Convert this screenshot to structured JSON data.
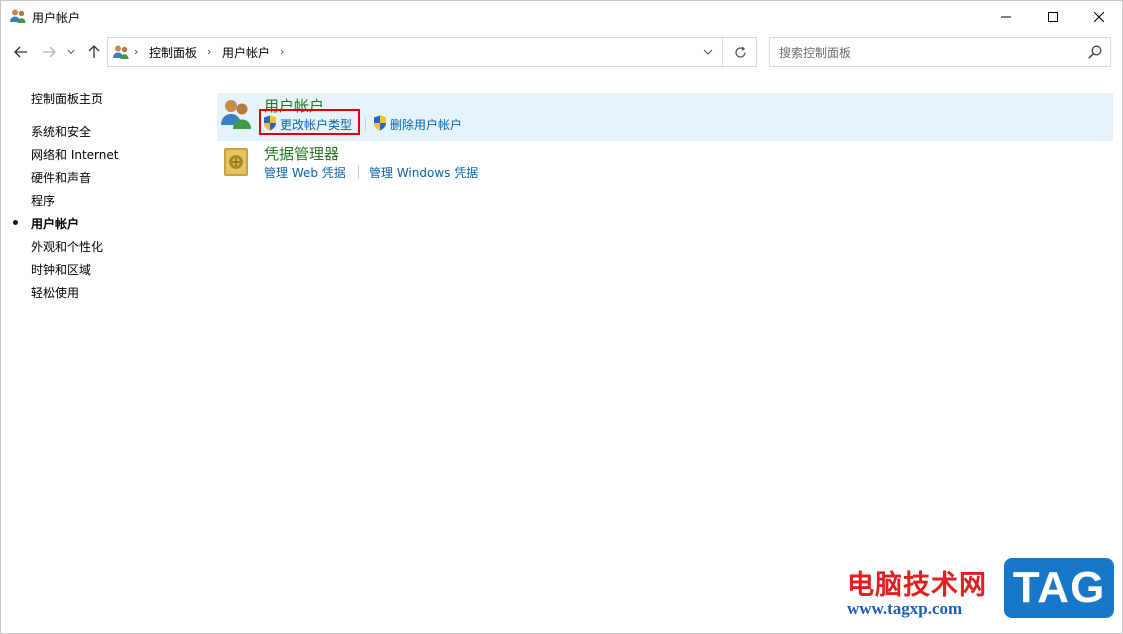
{
  "window": {
    "title": "用户帐户"
  },
  "nav": {
    "back_icon": "arrow-left-icon",
    "forward_icon": "arrow-right-icon",
    "recent_icon": "chevron-down-icon",
    "up_icon": "arrow-up-icon"
  },
  "address": {
    "crumbs": [
      "控制面板",
      "用户帐户"
    ],
    "separator": "›"
  },
  "search": {
    "placeholder": "搜索控制面板"
  },
  "sidebar": {
    "items": [
      {
        "label": "控制面板主页",
        "active": false
      },
      {
        "label": "系统和安全",
        "active": false
      },
      {
        "label": "网络和 Internet",
        "active": false
      },
      {
        "label": "硬件和声音",
        "active": false
      },
      {
        "label": "程序",
        "active": false
      },
      {
        "label": "用户帐户",
        "active": true
      },
      {
        "label": "外观和个性化",
        "active": false
      },
      {
        "label": "时钟和区域",
        "active": false
      },
      {
        "label": "轻松使用",
        "active": false
      }
    ]
  },
  "categories": [
    {
      "title": "用户帐户",
      "icon": "user-accounts-icon",
      "links": [
        "更改帐户类型",
        "删除用户帐户"
      ]
    },
    {
      "title": "凭据管理器",
      "icon": "credential-vault-icon",
      "links": [
        "管理 Web 凭据",
        "管理 Windows 凭据"
      ]
    }
  ],
  "colors": {
    "category_title": "#1e7b1e",
    "link": "#0a64ad",
    "highlight": "#e5f3fb",
    "annotation_box": "#e00000"
  },
  "watermark": {
    "site_name": "电脑技术网",
    "url": "www.tagxp.com",
    "badge": "TAG"
  }
}
